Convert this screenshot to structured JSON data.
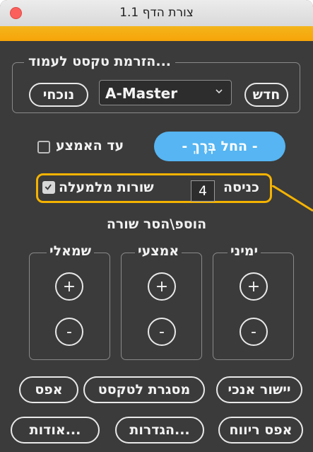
{
  "window": {
    "title": "צורת הדף 1.1"
  },
  "text_flow": {
    "legend": "הזרמת טקסט לעמוד...",
    "current_button": "נוכחי",
    "master_select": "A-Master",
    "new_button": "חדש"
  },
  "controls": {
    "until_middle_label": "עד האמצע",
    "start_button": "-  החל בְּרֶךְ  -",
    "lines_from_top_label": "שורות מלמעלה",
    "indent_label": "כניסה",
    "indent_value": "4"
  },
  "add_remove": {
    "title": "הוספ\\הסר שורה",
    "columns": [
      "ימיני",
      "אמצעי",
      "שמאלי"
    ],
    "plus_symbol": "+",
    "minus_symbol": "-"
  },
  "bottom": {
    "vertical_align": "יישור אנכי",
    "text_frame": "מסגרת לטקסט",
    "reset": "אפס",
    "reset_spacing": "אפס ריווח",
    "settings": "הגדרות...",
    "about": "אודות..."
  },
  "colors": {
    "accent": "#f7a408",
    "start_button": "#56b5f2",
    "highlight": "#f5b300",
    "panel": "#3b3b3b"
  },
  "state": {
    "until_middle_checked": false,
    "lines_from_top_checked": true
  }
}
